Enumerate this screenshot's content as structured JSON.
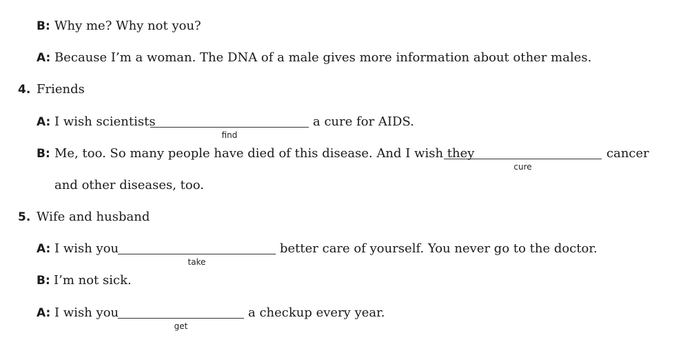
{
  "speakers": {
    "a": "A:",
    "b": "B:"
  },
  "line1": {
    "text": "Why me? Why not you?"
  },
  "line2": {
    "text": "Because I’m a woman. The DNA of a male gives more information about other males."
  },
  "item4": {
    "number": "4.",
    "title": "Friends"
  },
  "line3": {
    "before": "I wish scientists",
    "cue": "find",
    "after": "a cure for AIDS."
  },
  "line4": {
    "before": "Me, too. So many people have died of this disease. And I wish they",
    "cue": "cure",
    "after": "cancer"
  },
  "line5": {
    "text": "and other diseases, too."
  },
  "item5": {
    "number": "5.",
    "title": "Wife and husband"
  },
  "line6": {
    "before": "I wish you",
    "cue": "take",
    "after": "better care of yourself. You never go to the doctor."
  },
  "line7": {
    "text": "I’m not sick."
  },
  "line8": {
    "before": "I wish you",
    "cue": "get",
    "after": "a checkup every year."
  }
}
